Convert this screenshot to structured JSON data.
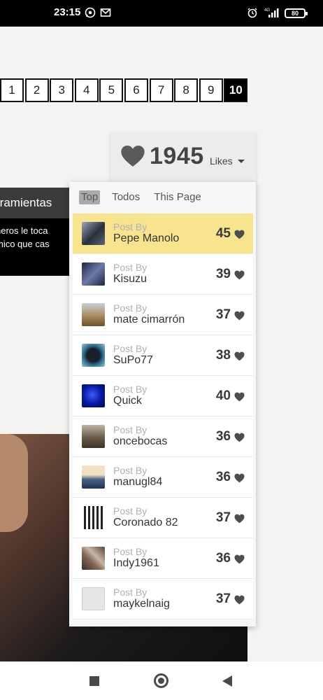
{
  "status_bar": {
    "time": "23:15",
    "battery": "80",
    "icons": [
      "whatsapp-icon",
      "gmail-icon",
      "alarm-icon",
      "signal-4g-icon",
      "battery-icon"
    ]
  },
  "pagination": {
    "pages": [
      "1",
      "2",
      "3",
      "4",
      "5",
      "6",
      "7",
      "8",
      "9",
      "10"
    ],
    "active": "10"
  },
  "tools_panel": {
    "title": "rramientas",
    "line1": "ñeros le toca",
    "line2": "mico que cas"
  },
  "likes": {
    "total": "1945",
    "label": "Likes",
    "tabs": [
      "Top",
      "Todos",
      "This Page"
    ],
    "active_tab": "Top",
    "post_by_label": "Post By",
    "entries": [
      {
        "user": "Pepe Manolo",
        "likes": "45",
        "thumb_color": "#2a2f3a"
      },
      {
        "user": "Kisuzu",
        "likes": "39",
        "thumb_color": "#1e2540"
      },
      {
        "user": "mate cimarrón",
        "likes": "37",
        "thumb_color": "#8c7b5a"
      },
      {
        "user": "SuPo77",
        "likes": "38",
        "thumb_color": "#2f6f8f"
      },
      {
        "user": "Quick",
        "likes": "40",
        "thumb_color": "#0a1aa8"
      },
      {
        "user": "oncebocas",
        "likes": "36",
        "thumb_color": "#6b5a47"
      },
      {
        "user": "manugl84",
        "likes": "36",
        "thumb_color": "#f0e1c2"
      },
      {
        "user": "Coronado 82",
        "likes": "37",
        "thumb_color": "#d8d8d8"
      },
      {
        "user": "Indy1961",
        "likes": "36",
        "thumb_color": "#8a6a5a"
      },
      {
        "user": "maykelnaig",
        "likes": "37",
        "thumb_color": "#e6e6e6"
      }
    ]
  },
  "colors": {
    "highlight_row": "#f8e38e",
    "page_active": "#000000"
  }
}
